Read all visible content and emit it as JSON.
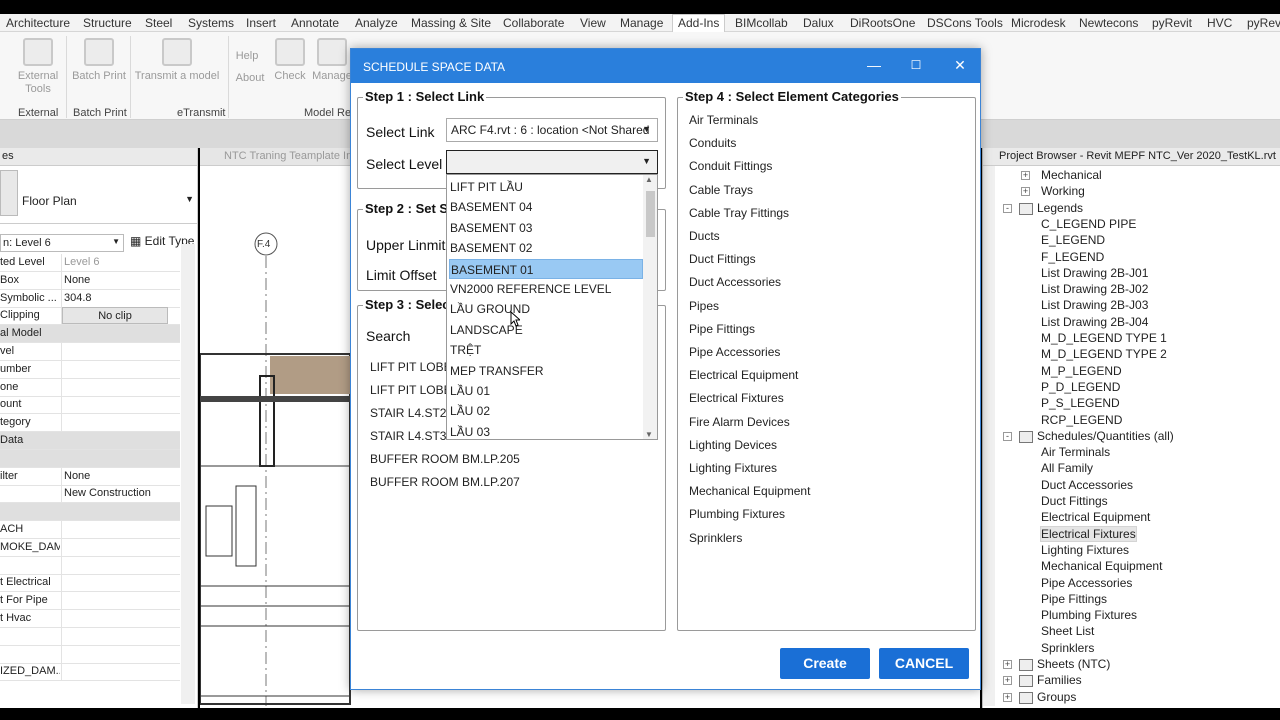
{
  "ribbon": {
    "tabs": [
      "Architecture",
      "Structure",
      "Steel",
      "Systems",
      "Insert",
      "Annotate",
      "Analyze",
      "Massing & Site",
      "Collaborate",
      "View",
      "Manage",
      "Add-Ins",
      "BIMcollab",
      "Dalux",
      "DiRootsOne",
      "DSCons Tools",
      "Microdesk",
      "Newtecons",
      "pyRevit",
      "HVC",
      "pyRevi"
    ],
    "active_tab": "Add-Ins",
    "buttons": {
      "external_tools": "External Tools",
      "batch_print": "Batch Print",
      "transmit": "Transmit a model",
      "help": "Help",
      "about": "About",
      "check": "Check",
      "manage": "Manage"
    },
    "panels": {
      "external": "External",
      "batch_print": "Batch Print",
      "etransmit": "eTransmit",
      "model_re": "Model Re"
    }
  },
  "properties": {
    "header": "es",
    "type_name": "Floor Plan",
    "instance_selector": "n: Level 6",
    "edit_type": "Edit Type",
    "rows": [
      {
        "k": "ted Level",
        "v": "Level 6",
        "dim": true
      },
      {
        "k": "Box",
        "v": "None"
      },
      {
        "k": "Symbolic ...",
        "v": "304.8"
      },
      {
        "k": "Clipping",
        "v": "No clip",
        "btn": true
      },
      {
        "k": "al Model",
        "v": "",
        "section": true
      },
      {
        "k": "vel",
        "v": ""
      },
      {
        "k": "umber",
        "v": ""
      },
      {
        "k": "one",
        "v": ""
      },
      {
        "k": "ount",
        "v": ""
      },
      {
        "k": "tegory",
        "v": ""
      },
      {
        "k": "Data",
        "v": "",
        "section": true
      },
      {
        "k": "",
        "v": "",
        "section": true
      },
      {
        "k": "ilter",
        "v": "None"
      },
      {
        "k": "",
        "v": "New Construction"
      },
      {
        "k": "",
        "v": "",
        "section": true
      },
      {
        "k": "ACH",
        "v": ""
      },
      {
        "k": "MOKE_DAM...",
        "v": ""
      },
      {
        "k": "",
        "v": ""
      },
      {
        "k": "t Electrical",
        "v": ""
      },
      {
        "k": "t For Pipe",
        "v": ""
      },
      {
        "k": "t Hvac",
        "v": ""
      },
      {
        "k": "",
        "v": ""
      },
      {
        "k": "",
        "v": ""
      },
      {
        "k": "IZED_DAM...",
        "v": ""
      }
    ]
  },
  "view": {
    "tab_title": "NTC Traning Teamplate In",
    "grid_label": "F.4"
  },
  "dialog": {
    "title": "SCHEDULE SPACE DATA",
    "step1": {
      "title": "Step 1 : Select Link",
      "select_link_label": "Select Link",
      "select_link_value": "ARC F4.rvt : 6 : location <Not Shared",
      "select_level_label": "Select Level",
      "select_level_value": ""
    },
    "step2": {
      "title": "Step 2 : Set S",
      "upper_limit_label": "Upper Linmit",
      "limit_offset_label": "Limit Offset"
    },
    "step3": {
      "title": "Step 3 : Selec",
      "search_label": "Search",
      "spaces": [
        "LIFT PIT LOBBY",
        "LIFT PIT LOBBY",
        "STAIR L4.ST2B L",
        "STAIR L4.ST3B L",
        "BUFFER ROOM BM.LP.205",
        "BUFFER ROOM BM.LP.207"
      ]
    },
    "level_options": [
      "LIFT PIT LẦU",
      "BASEMENT 04",
      "BASEMENT 03",
      "BASEMENT 02",
      "BASEMENT 01",
      "VN2000 REFERENCE LEVEL",
      "LẦU GROUND",
      "LANDSCAPE",
      "TRỆT",
      "MEP TRANSFER",
      "LẦU 01",
      "LẦU 02",
      "LẦU 03"
    ],
    "highlighted_option": "BASEMENT 01",
    "step4": {
      "title": "Step 4 : Select Element Categories",
      "categories": [
        "Air Terminals",
        "Conduits",
        "Conduit Fittings",
        "Cable Trays",
        "Cable Tray Fittings",
        "Ducts",
        "Duct Fittings",
        "Duct Accessories",
        "Pipes",
        "Pipe Fittings",
        "Pipe Accessories",
        "Electrical Equipment",
        "Electrical Fixtures",
        "Fire Alarm Devices",
        "Lighting Devices",
        "Lighting Fixtures",
        "Mechanical Equipment",
        "Plumbing Fixtures",
        "Sprinklers"
      ]
    },
    "create_label": "Create",
    "cancel_label": "CANCEL"
  },
  "browser": {
    "title": "Project Browser - Revit MEPF NTC_Ver 2020_TestKL.rvt",
    "items": [
      {
        "label": "Mechanical",
        "indent": 1,
        "exp": "+"
      },
      {
        "label": "Working",
        "indent": 1,
        "exp": "+"
      },
      {
        "label": "Legends",
        "indent": 0,
        "exp": "-",
        "icon": true
      },
      {
        "label": "C_LEGEND PIPE",
        "indent": 2
      },
      {
        "label": "E_LEGEND",
        "indent": 2
      },
      {
        "label": "F_LEGEND",
        "indent": 2
      },
      {
        "label": "List Drawing 2B-J01",
        "indent": 2
      },
      {
        "label": "List Drawing 2B-J02",
        "indent": 2
      },
      {
        "label": "List Drawing 2B-J03",
        "indent": 2
      },
      {
        "label": "List Drawing 2B-J04",
        "indent": 2
      },
      {
        "label": "M_D_LEGEND TYPE 1",
        "indent": 2
      },
      {
        "label": "M_D_LEGEND TYPE 2",
        "indent": 2
      },
      {
        "label": "M_P_LEGEND",
        "indent": 2
      },
      {
        "label": "P_D_LEGEND",
        "indent": 2
      },
      {
        "label": "P_S_LEGEND",
        "indent": 2
      },
      {
        "label": "RCP_LEGEND",
        "indent": 2
      },
      {
        "label": "Schedules/Quantities (all)",
        "indent": 0,
        "exp": "-",
        "icon": true
      },
      {
        "label": "Air Terminals",
        "indent": 2
      },
      {
        "label": "All Family",
        "indent": 2
      },
      {
        "label": "Duct Accessories",
        "indent": 2
      },
      {
        "label": "Duct Fittings",
        "indent": 2
      },
      {
        "label": "Electrical Equipment",
        "indent": 2
      },
      {
        "label": "Electrical Fixtures",
        "indent": 2,
        "selected": true
      },
      {
        "label": "Lighting Fixtures",
        "indent": 2
      },
      {
        "label": "Mechanical Equipment",
        "indent": 2
      },
      {
        "label": "Pipe Accessories",
        "indent": 2
      },
      {
        "label": "Pipe Fittings",
        "indent": 2
      },
      {
        "label": "Plumbing Fixtures",
        "indent": 2
      },
      {
        "label": "Sheet List",
        "indent": 2
      },
      {
        "label": "Sprinklers",
        "indent": 2
      },
      {
        "label": "Sheets (NTC)",
        "indent": 0,
        "exp": "+",
        "icon": true
      },
      {
        "label": "Families",
        "indent": 0,
        "exp": "+",
        "icon": true
      },
      {
        "label": "Groups",
        "indent": 0,
        "exp": "+",
        "icon": true
      }
    ]
  },
  "colors": {
    "dialog_title": "#2a7fdc",
    "button_blue": "#1a6fd6",
    "highlight": "#99c9f3"
  }
}
